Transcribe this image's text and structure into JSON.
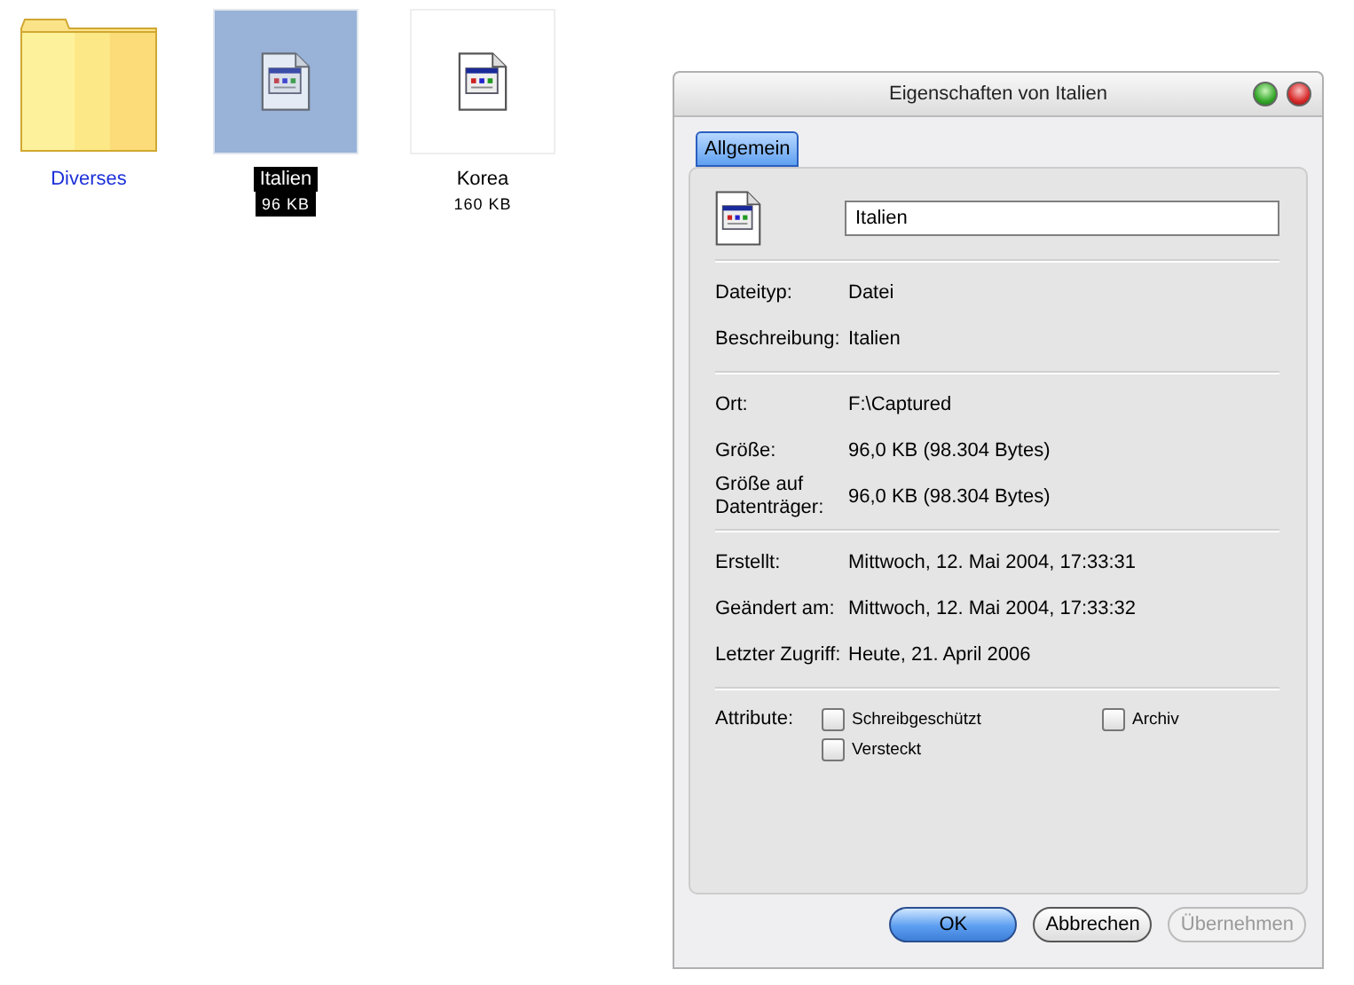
{
  "desktop_icons": [
    {
      "kind": "folder",
      "name": "Diverses",
      "selected": false
    },
    {
      "kind": "file",
      "name": "Italien",
      "size": "96 KB",
      "selected": true
    },
    {
      "kind": "file",
      "name": "Korea",
      "size": "160 KB",
      "selected": false
    }
  ],
  "window": {
    "title": "Eigenschaften von Italien"
  },
  "tabs": [
    {
      "label": "Allgemein",
      "selected": true
    }
  ],
  "name_field": {
    "value": "Italien"
  },
  "sections": [
    [
      {
        "label": "Dateityp:",
        "value": "Datei"
      },
      {
        "label": "Beschreibung:",
        "value": "Italien"
      }
    ],
    [
      {
        "label": "Ort:",
        "value": "F:\\Captured"
      },
      {
        "label": "Größe:",
        "value": "96,0 KB (98.304 Bytes)"
      },
      {
        "label": "Größe auf Datenträger:",
        "value": "96,0 KB (98.304 Bytes)"
      }
    ],
    [
      {
        "label": "Erstellt:",
        "value": "Mittwoch, 12. Mai 2004, 17:33:31"
      },
      {
        "label": "Geändert am:",
        "value": "Mittwoch, 12. Mai 2004, 17:33:32"
      },
      {
        "label": "Letzter Zugriff:",
        "value": "Heute, 21. April 2006"
      }
    ]
  ],
  "attributes": {
    "label": "Attribute:",
    "items": [
      {
        "label": "Schreibgeschützt",
        "checked": false
      },
      {
        "label": "Archiv",
        "checked": false
      },
      {
        "label": "Versteckt",
        "checked": false
      }
    ]
  },
  "buttons": [
    {
      "label": "OK",
      "kind": "default",
      "disabled": false
    },
    {
      "label": "Abbrechen",
      "kind": "normal",
      "disabled": false
    },
    {
      "label": "Übernehmen",
      "kind": "normal",
      "disabled": true
    }
  ]
}
